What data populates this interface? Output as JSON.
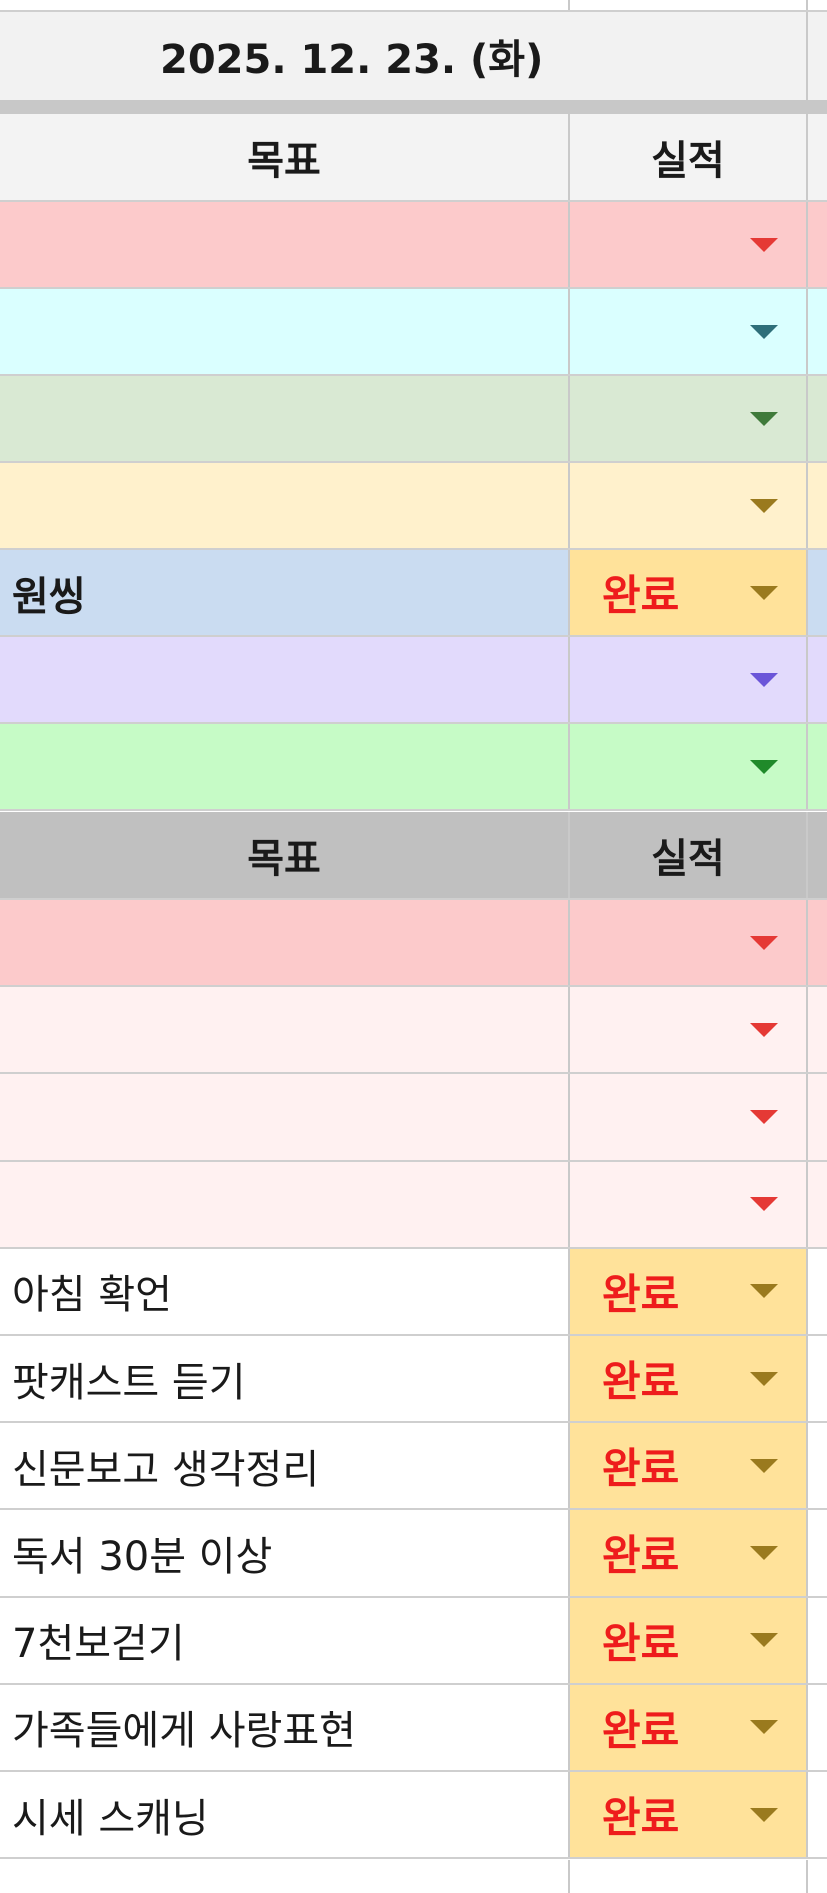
{
  "date_label": "2025. 12. 23. (화)",
  "header_goal": "목표",
  "header_result": "실적",
  "colors": {
    "red_band": "#fccacb",
    "cyan_band": "#daffff",
    "green_band": "#d9e9d3",
    "yellow_band": "#fff1cc",
    "blue_band": "#cadcf1",
    "purple_band": "#e2dafc",
    "lightgreen_band": "#c6fbc6",
    "pink_band": "#fff1f1",
    "header_gray": "#c0c0c0",
    "done_fill": "#ffe29a"
  },
  "section1": {
    "rows": [
      {
        "goal": "",
        "status": "",
        "arrow_color": "#e53935"
      },
      {
        "goal": "",
        "status": "",
        "arrow_color": "#2e6f7a"
      },
      {
        "goal": "",
        "status": "",
        "arrow_color": "#3f7a3a"
      },
      {
        "goal": "",
        "status": "",
        "arrow_color": "#9a7a1e"
      },
      {
        "goal": "원씽",
        "status": "완료",
        "arrow_color": "#9a7a1e"
      },
      {
        "goal": "",
        "status": "",
        "arrow_color": "#6a55d8"
      },
      {
        "goal": "",
        "status": "",
        "arrow_color": "#1f8a2a"
      }
    ]
  },
  "section2": {
    "rows": [
      {
        "goal": "",
        "status": "",
        "arrow_color": "#e53935"
      },
      {
        "goal": "",
        "status": "",
        "arrow_color": "#e53935"
      },
      {
        "goal": "",
        "status": "",
        "arrow_color": "#e53935"
      },
      {
        "goal": "",
        "status": "",
        "arrow_color": "#e53935"
      },
      {
        "goal": "아침 확언",
        "status": "완료",
        "arrow_color": "#9a7a1e"
      },
      {
        "goal": "팟캐스트 듣기",
        "status": "완료",
        "arrow_color": "#9a7a1e"
      },
      {
        "goal": "신문보고 생각정리",
        "status": "완료",
        "arrow_color": "#9a7a1e"
      },
      {
        "goal": "독서 30분 이상",
        "status": "완료",
        "arrow_color": "#9a7a1e"
      },
      {
        "goal": "7천보걷기",
        "status": "완료",
        "arrow_color": "#9a7a1e"
      },
      {
        "goal": "가족들에게 사랑표현",
        "status": "완료",
        "arrow_color": "#9a7a1e"
      },
      {
        "goal": "시세 스캐닝",
        "status": "완료",
        "arrow_color": "#9a7a1e"
      }
    ]
  }
}
